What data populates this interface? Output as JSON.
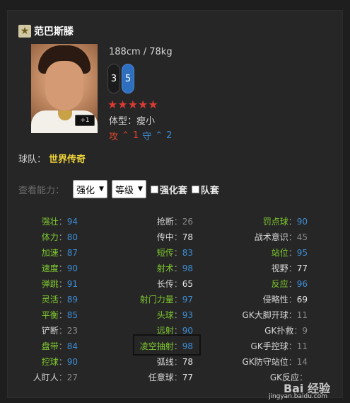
{
  "player": {
    "name": "范巴斯滕",
    "height_weight": "188cm / 78kg",
    "left_foot": "3",
    "right_foot": "5",
    "stars": "★★★★★",
    "body_type": "体型：瘦小",
    "work_rate": {
      "atk_label": "攻",
      "atk_arrow": "⌃",
      "atk_value": "1",
      "def_label": "守",
      "def_arrow": "⌃",
      "def_value": "2"
    },
    "plus_badge": "+1"
  },
  "team": {
    "label": "球队：",
    "name": "世界传奇"
  },
  "filter": {
    "label": "查看能力：",
    "enhance_select": "强化",
    "level_select": "等级",
    "enhance_set": "强化套",
    "team_set": "队套"
  },
  "colors": {
    "green_label": "#7ec92f",
    "blue_value": "#3d8ed6",
    "team_gold": "#f0d53a",
    "star_red": "#d83a33",
    "background": "#262626"
  },
  "attributes": {
    "col1": [
      {
        "label": "强壮",
        "value": "94"
      },
      {
        "label": "体力",
        "value": "80"
      },
      {
        "label": "加速",
        "value": "87"
      },
      {
        "label": "速度",
        "value": "90"
      },
      {
        "label": "弹跳",
        "value": "91"
      },
      {
        "label": "灵活",
        "value": "89"
      },
      {
        "label": "平衡",
        "value": "85"
      },
      {
        "label": "铲断",
        "value": "23"
      },
      {
        "label": "盘带",
        "value": "84"
      },
      {
        "label": "控球",
        "value": "90"
      },
      {
        "label": "人盯人",
        "value": "27"
      }
    ],
    "col2": [
      {
        "label": "抢断",
        "value": "26"
      },
      {
        "label": "传中",
        "value": "78"
      },
      {
        "label": "短传",
        "value": "83"
      },
      {
        "label": "射术",
        "value": "98"
      },
      {
        "label": "长传",
        "value": "65"
      },
      {
        "label": "射门力量",
        "value": "97"
      },
      {
        "label": "头球",
        "value": "93"
      },
      {
        "label": "远射",
        "value": "90"
      },
      {
        "label": "凌空抽射",
        "value": "98"
      },
      {
        "label": "弧线",
        "value": "78"
      },
      {
        "label": "任意球",
        "value": "77"
      }
    ],
    "col3": [
      {
        "label": "罚点球",
        "value": "90"
      },
      {
        "label": "战术意识",
        "value": "45"
      },
      {
        "label": "站位",
        "value": "95"
      },
      {
        "label": "视野",
        "value": "77"
      },
      {
        "label": "反应",
        "value": "96"
      },
      {
        "label": "侵略性",
        "value": "69"
      },
      {
        "label": "GK大脚开球",
        "value": "11"
      },
      {
        "label": "GK扑救",
        "value": "9"
      },
      {
        "label": "GK手控球",
        "value": "11"
      },
      {
        "label": "GK防守站位",
        "value": "14"
      },
      {
        "label": "GK反应",
        "value": ""
      }
    ]
  },
  "watermark": {
    "text": "Bai 经验",
    "url": "jingyan.baidu.com"
  }
}
